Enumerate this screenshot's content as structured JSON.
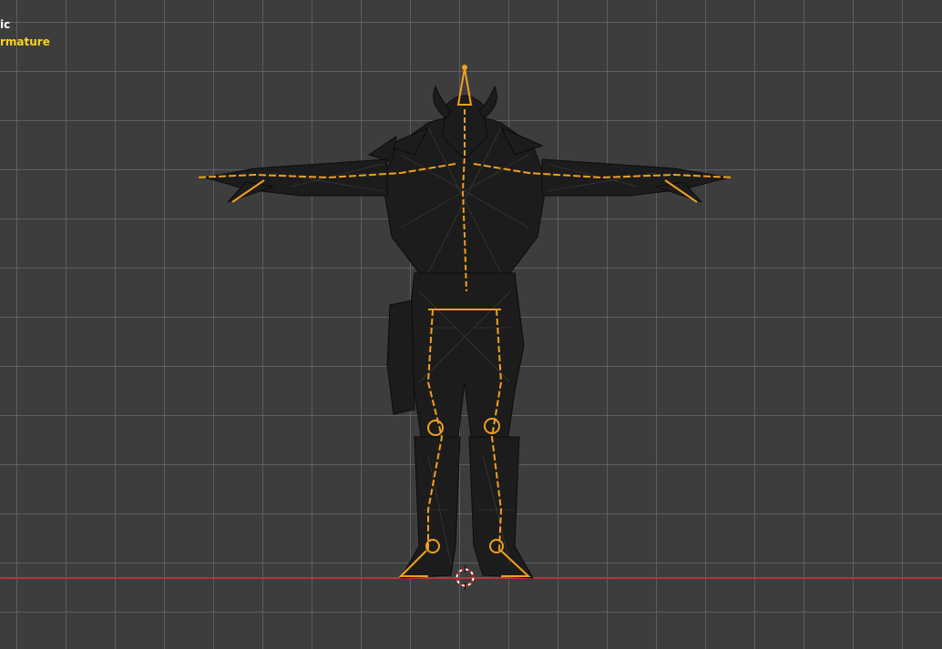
{
  "viewport": {
    "view_name": "ic",
    "object_name": "rmature"
  },
  "colors": {
    "background": "#3d3d3d",
    "grid": "#787878",
    "x_axis": "#b8323e",
    "armature": "#f0a020",
    "mesh_wire": "#111111",
    "object_label": "#ffd21e"
  },
  "icons": {
    "cursor": "3d-cursor-icon"
  }
}
